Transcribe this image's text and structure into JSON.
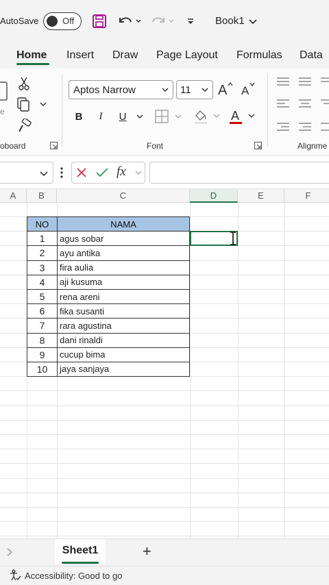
{
  "titlebar": {
    "autosave_label": "AutoSave",
    "autosave_state": "Off",
    "book_title": "Book1"
  },
  "tabs": [
    {
      "label": "Home",
      "active": true
    },
    {
      "label": "Insert"
    },
    {
      "label": "Draw"
    },
    {
      "label": "Page Layout"
    },
    {
      "label": "Formulas"
    },
    {
      "label": "Data"
    }
  ],
  "ribbon": {
    "font_name": "Aptos Narrow",
    "font_size": "11",
    "bold": "B",
    "italic": "I",
    "underline": "U",
    "font_color_letter": "A",
    "font_color": "#d40000",
    "groups": {
      "clipboard": "oboard",
      "font": "Font",
      "alignment": "Alignme"
    }
  },
  "formula_bar": {
    "fx": "fx",
    "value": ""
  },
  "columns": [
    "A",
    "B",
    "C",
    "D",
    "E",
    "F"
  ],
  "table": {
    "headers": [
      "NO",
      "NAMA"
    ],
    "rows": [
      [
        "1",
        "agus sobar"
      ],
      [
        "2",
        "ayu antika"
      ],
      [
        "3",
        "fira aulia"
      ],
      [
        "4",
        "aji kusuma"
      ],
      [
        "5",
        "rena areni"
      ],
      [
        "6",
        "fika susanti"
      ],
      [
        "7",
        "rara agustina"
      ],
      [
        "8",
        "dani rinaldi"
      ],
      [
        "9",
        "cucup bima"
      ],
      [
        "10",
        "jaya sanjaya"
      ]
    ],
    "header_color": "#a7c4e4"
  },
  "sheets": {
    "active": "Sheet1",
    "add": "+"
  },
  "status": {
    "accessibility": "Accessibility: Good to go"
  },
  "colors": {
    "accent": "#217346",
    "ribbon_bg": "#f3f3f3"
  }
}
